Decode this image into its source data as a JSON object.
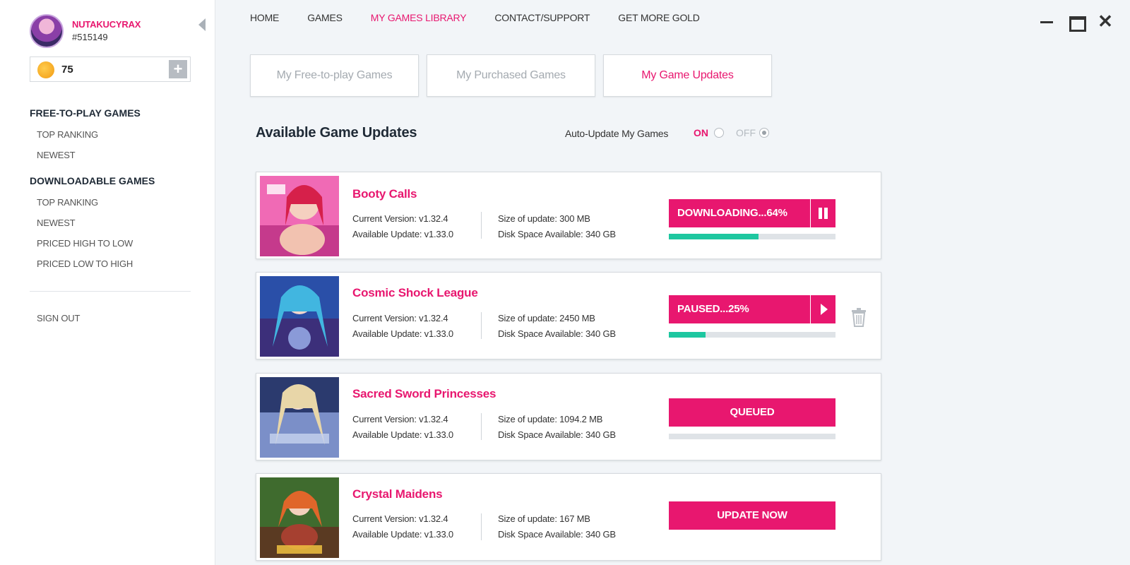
{
  "user": {
    "name": "NUTAKUCYRAX",
    "id": "#515149",
    "gold": "75"
  },
  "sidebar": {
    "sections": [
      {
        "title": "FREE-TO-PLAY GAMES",
        "items": [
          "TOP RANKING",
          "NEWEST"
        ]
      },
      {
        "title": "DOWNLOADABLE GAMES",
        "items": [
          "TOP RANKING",
          "NEWEST",
          "PRICED HIGH TO LOW",
          "PRICED LOW TO HIGH"
        ]
      }
    ],
    "sign_out": "SIGN OUT"
  },
  "nav": {
    "items": [
      "HOME",
      "GAMES",
      "MY GAMES LIBRARY",
      "CONTACT/SUPPORT",
      "GET MORE GOLD"
    ],
    "active": "MY GAMES LIBRARY"
  },
  "tabs": [
    "My Free-to-play Games",
    "My Purchased Games",
    "My Game Updates"
  ],
  "active_tab": "My Game Updates",
  "updates": {
    "heading": "Available Game Updates",
    "auto_update_label": "Auto-Update My Games",
    "on_label": "ON",
    "off_label": "OFF",
    "auto_update_selected": "OFF"
  },
  "games": [
    {
      "title": "Booty Calls",
      "current_version": "Current Version: v1.32.4",
      "available_update": "Available Update: v1.33.0",
      "size": "Size of update: 300 MB",
      "disk": "Disk Space Available: 340 GB",
      "action": "DOWNLOADING...64%",
      "state": "downloading",
      "progress": 54
    },
    {
      "title": "Cosmic Shock League",
      "current_version": "Current Version: v1.32.4",
      "available_update": "Available Update: v1.33.0",
      "size": "Size of update: 2450 MB",
      "disk": "Disk Space Available: 340 GB",
      "action": "PAUSED...25%",
      "state": "paused",
      "progress": 22
    },
    {
      "title": "Sacred Sword Princesses",
      "current_version": "Current Version: v1.32.4",
      "available_update": "Available Update: v1.33.0",
      "size": "Size of update: 1094.2 MB",
      "disk": "Disk Space Available: 340 GB",
      "action": "QUEUED",
      "state": "queued",
      "progress": 0
    },
    {
      "title": "Crystal Maidens",
      "current_version": "Current Version: v1.32.4",
      "available_update": "Available Update: v1.33.0",
      "size": "Size of update: 167 MB",
      "disk": "Disk Space Available: 340 GB",
      "action": "UPDATE NOW",
      "state": "update",
      "progress": null
    }
  ],
  "colors": {
    "accent": "#e8176f",
    "progress": "#1ec7a0",
    "heading": "#1f2a36"
  }
}
